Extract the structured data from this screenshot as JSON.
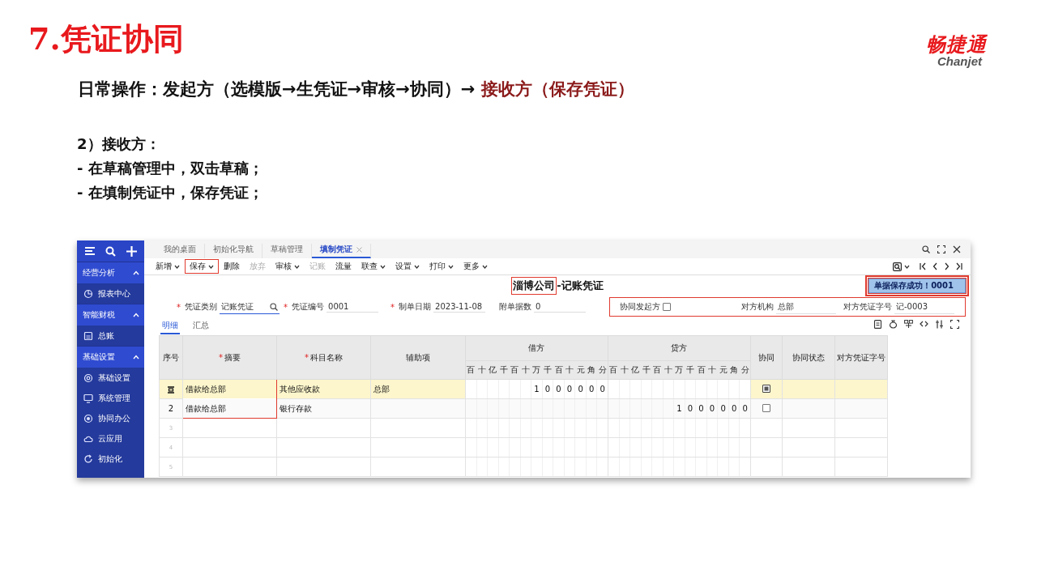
{
  "slide": {
    "title": "7.凭证协同",
    "logo": {
      "name": "畅捷通",
      "subtitle": "Chanjet"
    },
    "headline": {
      "text": "日常操作：发起方（选模版→生凭证→审核→协同）→ ",
      "emphasis": "接收方（保存凭证）"
    },
    "notes": [
      "2）接收方：",
      "- 在草稿管理中，双击草稿；",
      "- 在填制凭证中，保存凭证；"
    ]
  },
  "app": {
    "sidebar": {
      "groups": [
        {
          "label": "经营分析",
          "expanded": true,
          "items": [
            {
              "label": "报表中心"
            }
          ]
        },
        {
          "label": "智能财税",
          "expanded": true,
          "items": [
            {
              "label": "总账"
            }
          ]
        },
        {
          "label": "基础设置",
          "expanded": true,
          "items": [
            {
              "label": "基础设置"
            },
            {
              "label": "系统管理"
            },
            {
              "label": "协同办公"
            },
            {
              "label": "云应用"
            },
            {
              "label": "初始化"
            }
          ]
        }
      ]
    },
    "tabs": [
      {
        "label": "我的桌面",
        "selected": false
      },
      {
        "label": "初始化导航",
        "selected": false
      },
      {
        "label": "草稿管理",
        "selected": false
      },
      {
        "label": "填制凭证",
        "selected": true
      }
    ],
    "toolbar": [
      {
        "label": "新增",
        "dropdown": true,
        "disabled": false,
        "annotated": false
      },
      {
        "label": "保存",
        "dropdown": true,
        "disabled": false,
        "annotated": true
      },
      {
        "label": "删除",
        "dropdown": false,
        "disabled": false,
        "annotated": false
      },
      {
        "label": "放弃",
        "dropdown": false,
        "disabled": true,
        "annotated": false
      },
      {
        "label": "审核",
        "dropdown": true,
        "disabled": false,
        "annotated": false
      },
      {
        "label": "记账",
        "dropdown": false,
        "disabled": true,
        "annotated": false
      },
      {
        "label": "流量",
        "dropdown": false,
        "disabled": false,
        "annotated": false
      },
      {
        "label": "联查",
        "dropdown": true,
        "disabled": false,
        "annotated": false
      },
      {
        "label": "设置",
        "dropdown": true,
        "disabled": false,
        "annotated": false
      },
      {
        "label": "打印",
        "dropdown": true,
        "disabled": false,
        "annotated": false
      },
      {
        "label": "更多",
        "dropdown": true,
        "disabled": false,
        "annotated": false
      }
    ],
    "voucher_title": {
      "company": "淄博公司",
      "suffix": "-记账凭证",
      "annotated": true
    },
    "message": {
      "text": "单据保存成功！0001",
      "annotated": true
    },
    "fields": [
      {
        "label": "凭证类别",
        "mark": "*",
        "value": "记账凭证",
        "kind": "lookup"
      },
      {
        "label": "凭证编号",
        "mark": "*",
        "value": "0001",
        "kind": "text"
      },
      {
        "label": "制单日期",
        "mark": "*",
        "value": "2023-11-08",
        "kind": "text"
      },
      {
        "label": "附单据数",
        "value": "0",
        "kind": "text"
      }
    ],
    "collab_fields": {
      "annotated": true,
      "items": [
        {
          "label": "协同发起方",
          "kind": "checkbox",
          "checked": false
        },
        {
          "label": "对方机构",
          "kind": "text",
          "value": "总部"
        },
        {
          "label": "对方凭证字号",
          "kind": "text",
          "value": "记-0003"
        }
      ]
    },
    "subtabs": [
      {
        "label": "明细",
        "selected": true
      },
      {
        "label": "汇总",
        "selected": false
      }
    ],
    "table": {
      "columns": [
        {
          "label": "序号",
          "kind": "text"
        },
        {
          "label": "摘要",
          "mark": "*",
          "kind": "text"
        },
        {
          "label": "科目名称",
          "mark": "*",
          "kind": "text"
        },
        {
          "label": "辅助项",
          "kind": "text"
        },
        {
          "label": "借方",
          "kind": "amount",
          "digits": [
            "百",
            "十",
            "亿",
            "千",
            "百",
            "十",
            "万",
            "千",
            "百",
            "十",
            "元",
            "角",
            "分"
          ]
        },
        {
          "label": "贷方",
          "kind": "amount",
          "digits": [
            "百",
            "十",
            "亿",
            "千",
            "百",
            "十",
            "万",
            "千",
            "百",
            "十",
            "元",
            "角",
            "分"
          ]
        },
        {
          "label": "协同",
          "kind": "check"
        },
        {
          "label": "协同状态",
          "kind": "text"
        },
        {
          "label": "对方凭证字号",
          "kind": "text"
        }
      ],
      "rows": [
        {
          "kind": "current",
          "selected": true,
          "summary": {
            "text": "借款给总部",
            "annotated": true
          },
          "account": "其他应收款",
          "aux": "总部",
          "debit": [
            "1",
            "0",
            "0",
            "0",
            "0",
            "0",
            "0"
          ],
          "collab": {
            "checked": true
          }
        },
        {
          "kind": "entry",
          "selected": false,
          "no": "2",
          "summary": {
            "text": "借款给总部",
            "annotated": true
          },
          "account": "银行存款",
          "credit": [
            "1",
            "0",
            "0",
            "0",
            "0",
            "0",
            "0"
          ],
          "collab": {
            "checked": false
          }
        },
        {
          "kind": "blank",
          "selected": false,
          "no": "3"
        },
        {
          "kind": "blank",
          "selected": false,
          "no": "4"
        },
        {
          "kind": "blank",
          "selected": false,
          "no": "5"
        }
      ]
    }
  }
}
